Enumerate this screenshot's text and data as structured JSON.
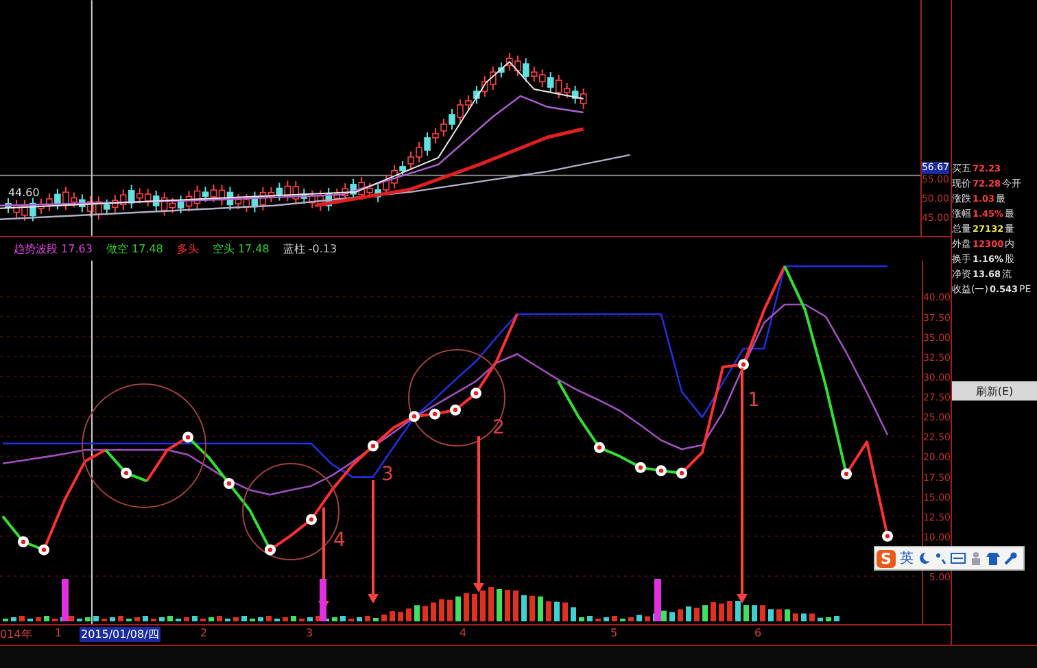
{
  "price_chart": {
    "low_label": "44.60"
  },
  "price_axis": [
    {
      "label": "56.67",
      "selected": true
    },
    {
      "label": "55.00",
      "selected": false
    },
    {
      "label": "50.00",
      "selected": false
    },
    {
      "label": "45.00",
      "selected": false
    }
  ],
  "quote_panel": {
    "rows": [
      {
        "label": "买五",
        "value": "72.23",
        "tail": "",
        "color": "#ff3b3b"
      },
      {
        "label": "现价",
        "value": "72.28",
        "tail": "今开",
        "color": "#ff3b3b"
      },
      {
        "label": "涨跌",
        "value": "1.03",
        "tail": "最",
        "color": "#ff3b3b"
      },
      {
        "label": "涨幅",
        "value": "1.45%",
        "tail": "最",
        "color": "#ff3b3b"
      },
      {
        "label": "总量",
        "value": "27132",
        "tail": "量",
        "color": "#e8e040"
      },
      {
        "label": "外盘",
        "value": "12300",
        "tail": "内",
        "color": "#ff3b3b"
      },
      {
        "label": "换手",
        "value": "1.16%",
        "tail": "股",
        "color": "#e0e0e0"
      },
      {
        "label": "净资",
        "value": "13.68",
        "tail": "流",
        "color": "#e0e0e0"
      },
      {
        "label": "收益(一)",
        "value": "0.543",
        "tail": "PE",
        "color": "#e0e0e0"
      }
    ]
  },
  "indicator": {
    "legend": [
      {
        "text": "趋势波段 17.63",
        "color": "#e040e0"
      },
      {
        "text": "做空 17.48",
        "color": "#30d030"
      },
      {
        "text": "多头",
        "color": "#ff3030"
      },
      {
        "text": "空头 17.48",
        "color": "#30d030"
      },
      {
        "text": "蓝柱 -0.13",
        "color": "#c8c8c8"
      }
    ],
    "chart_data": {
      "type": "line",
      "grid": true,
      "ylim": [
        -1,
        44.5
      ],
      "yticks": [
        {
          "value": 40,
          "label": "40.00"
        },
        {
          "value": 37.5,
          "label": "37.50"
        },
        {
          "value": 35,
          "label": "35.00"
        },
        {
          "value": 32.5,
          "label": "32.50"
        },
        {
          "value": 30,
          "label": "30.00"
        },
        {
          "value": 27.5,
          "label": "27.50"
        },
        {
          "value": 25,
          "label": "25.00"
        },
        {
          "value": 22.5,
          "label": "22.50"
        },
        {
          "value": 20,
          "label": "20.00"
        },
        {
          "value": 17.5,
          "label": "17.50"
        },
        {
          "value": 15,
          "label": "15.00"
        },
        {
          "value": 12.5,
          "label": "12.50"
        },
        {
          "value": 10,
          "label": "10.00"
        },
        {
          "value": 5,
          "label": "5.00"
        }
      ],
      "series": [
        {
          "color": "#2030e0",
          "values": [
            21.6,
            21.6,
            21.6,
            21.6,
            21.6,
            21.6,
            21.6,
            21.6,
            21.6,
            21.6,
            21.6,
            21.6,
            21.6,
            21.6,
            21.6,
            21.6,
            19.0,
            17.4,
            17.4,
            21.2,
            24.9,
            27.2,
            29.6,
            31.9,
            34.9,
            37.8,
            37.8,
            37.8,
            37.8,
            37.8,
            37.8,
            37.8,
            37.8,
            28.1,
            24.9,
            29.2,
            33.5,
            33.5,
            43.8,
            43.8,
            43.8,
            43.8,
            43.8,
            43.8
          ]
        },
        {
          "color": "#a050c0",
          "values": [
            19.1,
            19.5,
            19.9,
            20.3,
            20.8,
            20.8,
            20.8,
            20.8,
            20.8,
            20.2,
            18.6,
            17.0,
            15.8,
            15.2,
            15.8,
            16.3,
            17.6,
            19.3,
            21.2,
            23.0,
            24.9,
            26.4,
            27.9,
            29.4,
            31.7,
            32.8,
            31.2,
            29.6,
            28.2,
            27.0,
            25.7,
            23.9,
            22.0,
            20.9,
            21.4,
            25.5,
            31.3,
            36.7,
            39.0,
            39.0,
            37.5,
            33.0,
            28.0,
            22.7
          ]
        },
        {
          "color": "#ff3030",
          "values": [
            null,
            null,
            8.3,
            14.5,
            19.4,
            20.8,
            null,
            16.9,
            20.8,
            22.4,
            null,
            null,
            null,
            8.3,
            10.1,
            12.1,
            15.8,
            18.9,
            21.3,
            23.6,
            25.0,
            25.3,
            25.8,
            27.9,
            31.9,
            37.8,
            null,
            null,
            null,
            null,
            null,
            null,
            null,
            17.9,
            20.5,
            31.2,
            31.5,
            38.3,
            43.8,
            null,
            null,
            17.8,
            21.8,
            10.0
          ]
        },
        {
          "color": "#30e030",
          "values": [
            12.5,
            9.3,
            8.3,
            null,
            null,
            20.8,
            17.9,
            16.9,
            null,
            22.4,
            19.9,
            16.6,
            13.3,
            8.3,
            null,
            null,
            null,
            null,
            null,
            null,
            null,
            null,
            null,
            null,
            null,
            null,
            null,
            29.4,
            24.9,
            21.1,
            20.0,
            18.6,
            18.2,
            17.9,
            null,
            null,
            null,
            null,
            43.8,
            38.3,
            28.8,
            17.8,
            null,
            null
          ]
        }
      ]
    },
    "annotations": [
      "1",
      "2",
      "3",
      "4"
    ]
  },
  "time_axis": [
    {
      "label": "014年",
      "selected": false
    },
    {
      "label": "1",
      "selected": false
    },
    {
      "label": "2015/01/08/四",
      "selected": true
    },
    {
      "label": "2",
      "selected": false
    },
    {
      "label": "3",
      "selected": false
    },
    {
      "label": "4",
      "selected": false
    },
    {
      "label": "5",
      "selected": false
    },
    {
      "label": "6",
      "selected": false
    }
  ],
  "context_menu": {
    "items": [
      "刷新(E)"
    ]
  },
  "ime_toolbar": {
    "logo": "S",
    "mode": "英"
  }
}
